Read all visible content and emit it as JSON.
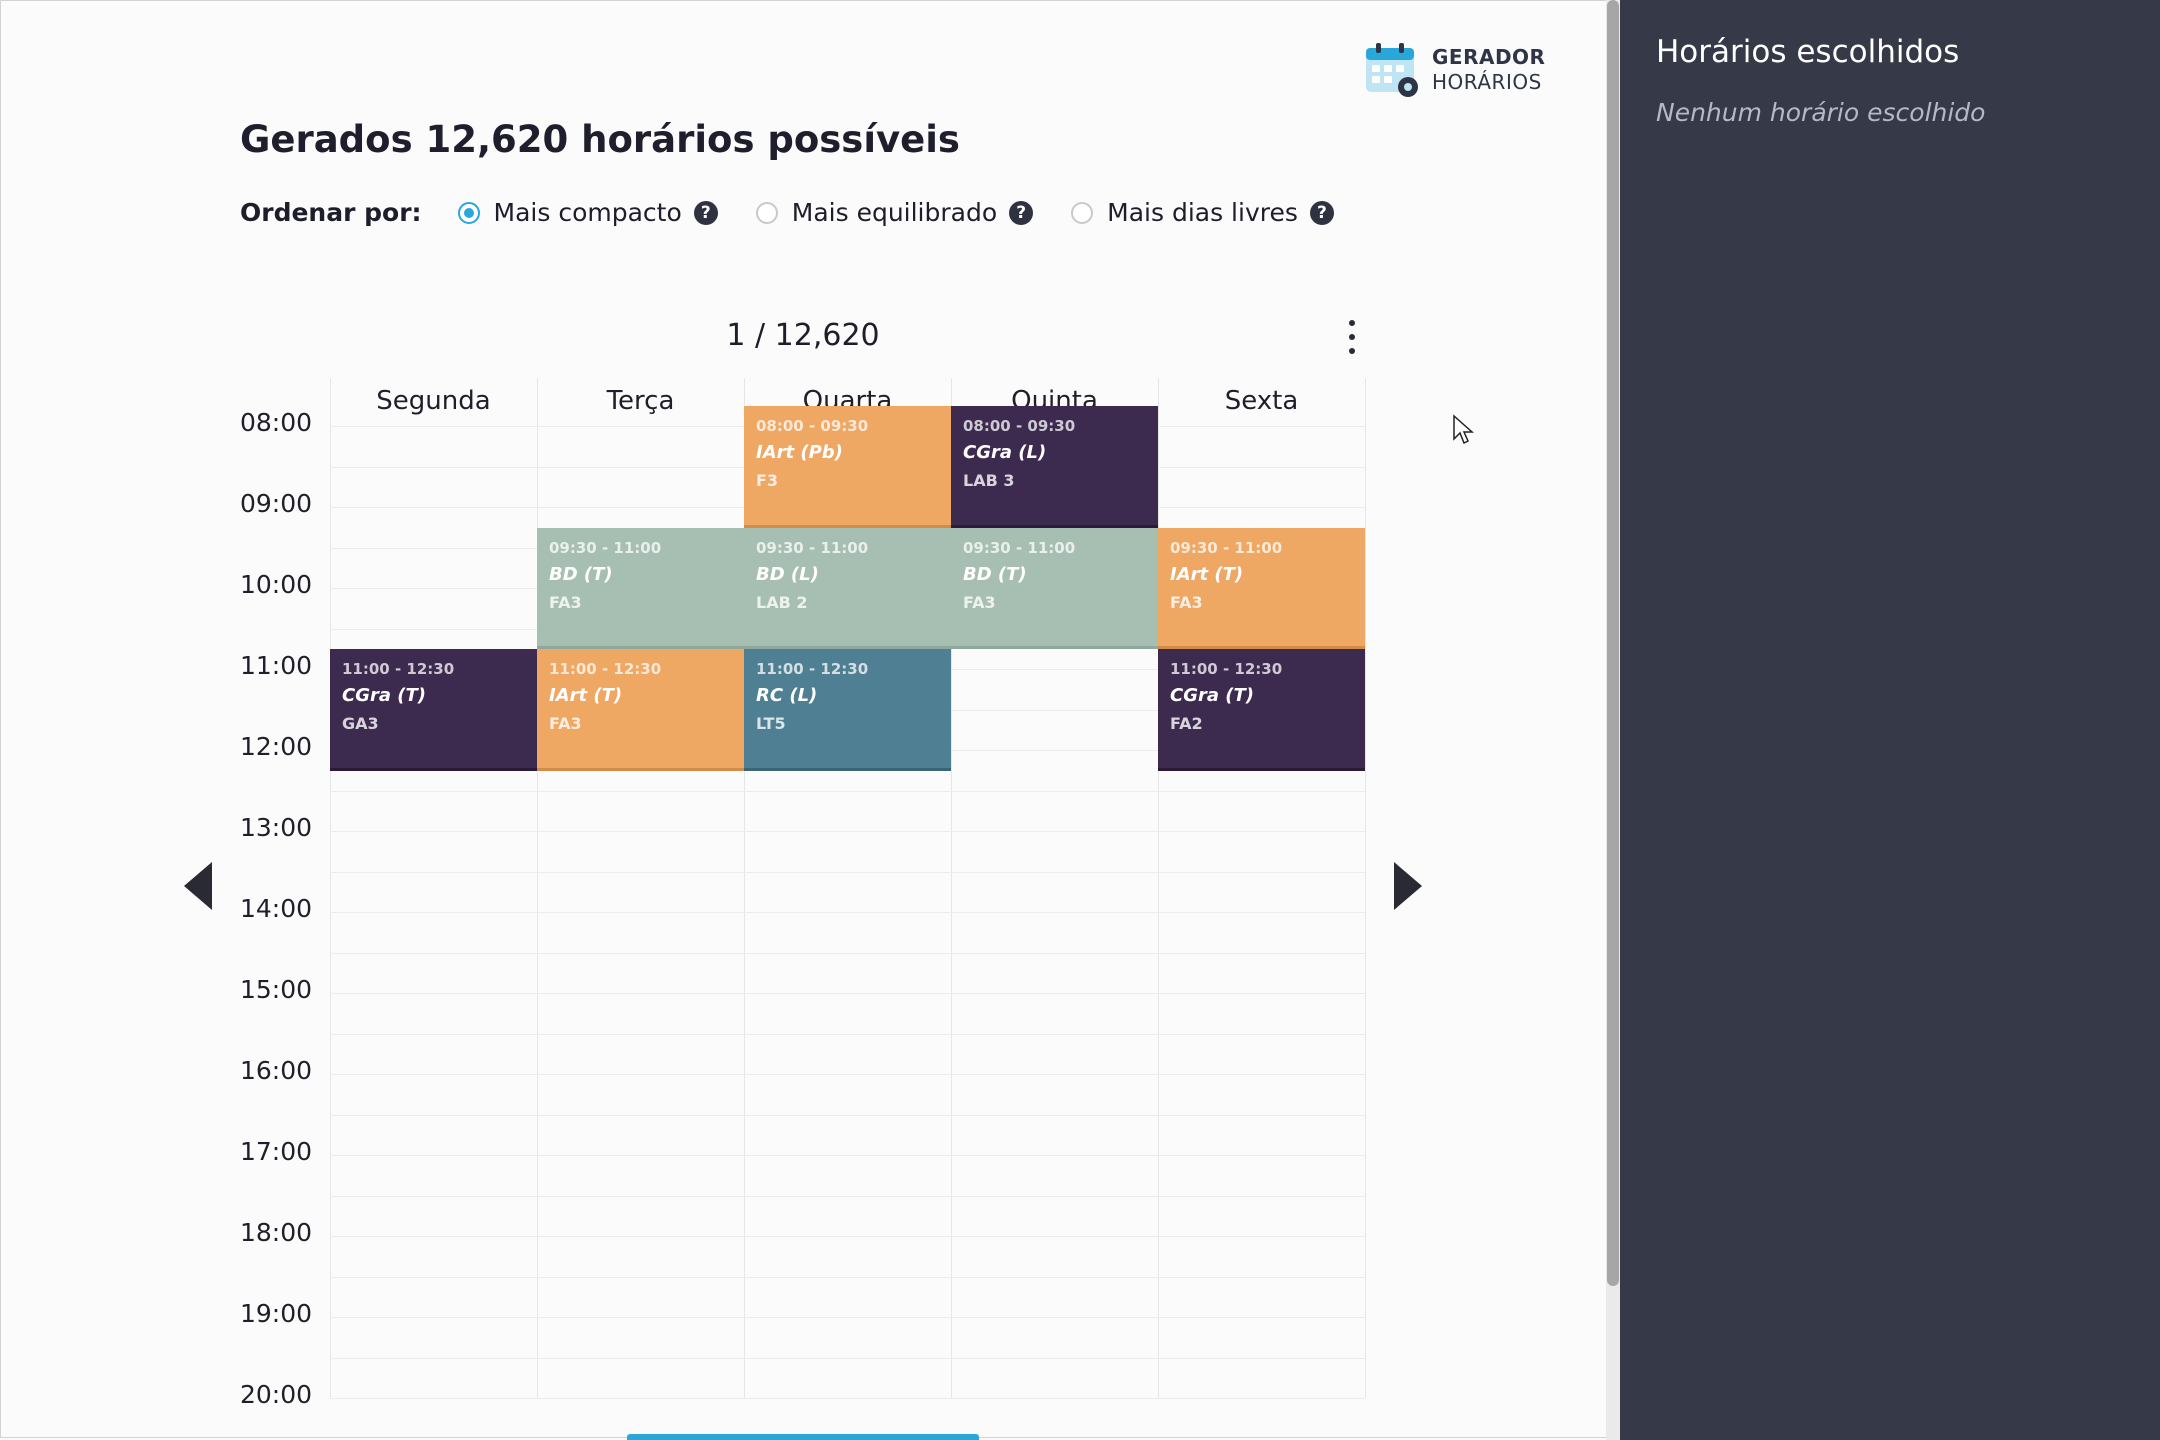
{
  "logo": {
    "line1": "GERADOR",
    "line2": "HORÁRIOS"
  },
  "header": {
    "title": "Gerados 12,620 horários possíveis"
  },
  "sort": {
    "label": "Ordenar por:",
    "options": [
      {
        "label": "Mais compacto",
        "checked": true
      },
      {
        "label": "Mais equilibrado",
        "checked": false
      },
      {
        "label": "Mais dias livres",
        "checked": false
      }
    ],
    "help_glyph": "?"
  },
  "pagination": {
    "counter": "1 / 12,620"
  },
  "schedule": {
    "days": [
      "Segunda",
      "Terça",
      "Quarta",
      "Quinta",
      "Sexta"
    ],
    "times": [
      "08:00",
      "09:00",
      "10:00",
      "11:00",
      "12:00",
      "13:00",
      "14:00",
      "15:00",
      "16:00",
      "17:00",
      "18:00",
      "19:00",
      "20:00"
    ],
    "events": [
      {
        "day": 2,
        "start": 8.0,
        "end": 9.5,
        "time": "08:00 - 09:30",
        "name": "IArt (Pb)",
        "room": "F3",
        "color": "orange"
      },
      {
        "day": 3,
        "start": 8.0,
        "end": 9.5,
        "time": "08:00 - 09:30",
        "name": "CGra (L)",
        "room": "LAB 3",
        "color": "purple"
      },
      {
        "day": 1,
        "start": 9.5,
        "end": 11.0,
        "time": "09:30 - 11:00",
        "name": "BD (T)",
        "room": "FA3",
        "color": "sage"
      },
      {
        "day": 2,
        "start": 9.5,
        "end": 11.0,
        "time": "09:30 - 11:00",
        "name": "BD (L)",
        "room": "LAB 2",
        "color": "sage"
      },
      {
        "day": 3,
        "start": 9.5,
        "end": 11.0,
        "time": "09:30 - 11:00",
        "name": "BD (T)",
        "room": "FA3",
        "color": "sage"
      },
      {
        "day": 4,
        "start": 9.5,
        "end": 11.0,
        "time": "09:30 - 11:00",
        "name": "IArt (T)",
        "room": "FA3",
        "color": "orange"
      },
      {
        "day": 0,
        "start": 11.0,
        "end": 12.5,
        "time": "11:00 - 12:30",
        "name": "CGra (T)",
        "room": "GA3",
        "color": "purple"
      },
      {
        "day": 1,
        "start": 11.0,
        "end": 12.5,
        "time": "11:00 - 12:30",
        "name": "IArt (T)",
        "room": "FA3",
        "color": "orange"
      },
      {
        "day": 2,
        "start": 11.0,
        "end": 12.5,
        "time": "11:00 - 12:30",
        "name": "RC (L)",
        "room": "LT5",
        "color": "teal"
      },
      {
        "day": 4,
        "start": 11.0,
        "end": 12.5,
        "time": "11:00 - 12:30",
        "name": "CGra (T)",
        "room": "FA2",
        "color": "purple"
      }
    ]
  },
  "sidebar": {
    "title": "Horários escolhidos",
    "empty": "Nenhum horário escolhido"
  },
  "colors": {
    "accent": "#2aa7d9",
    "orange": "#efa764",
    "purple": "#3c2a4f",
    "sage": "#a7bfb3",
    "teal": "#4f7f92",
    "sidebar_bg": "#363a48"
  },
  "icons": [
    "calendar-gear-icon",
    "help-icon",
    "kebab-menu-icon",
    "chevron-left-icon",
    "chevron-right-icon",
    "mouse-cursor-icon"
  ]
}
